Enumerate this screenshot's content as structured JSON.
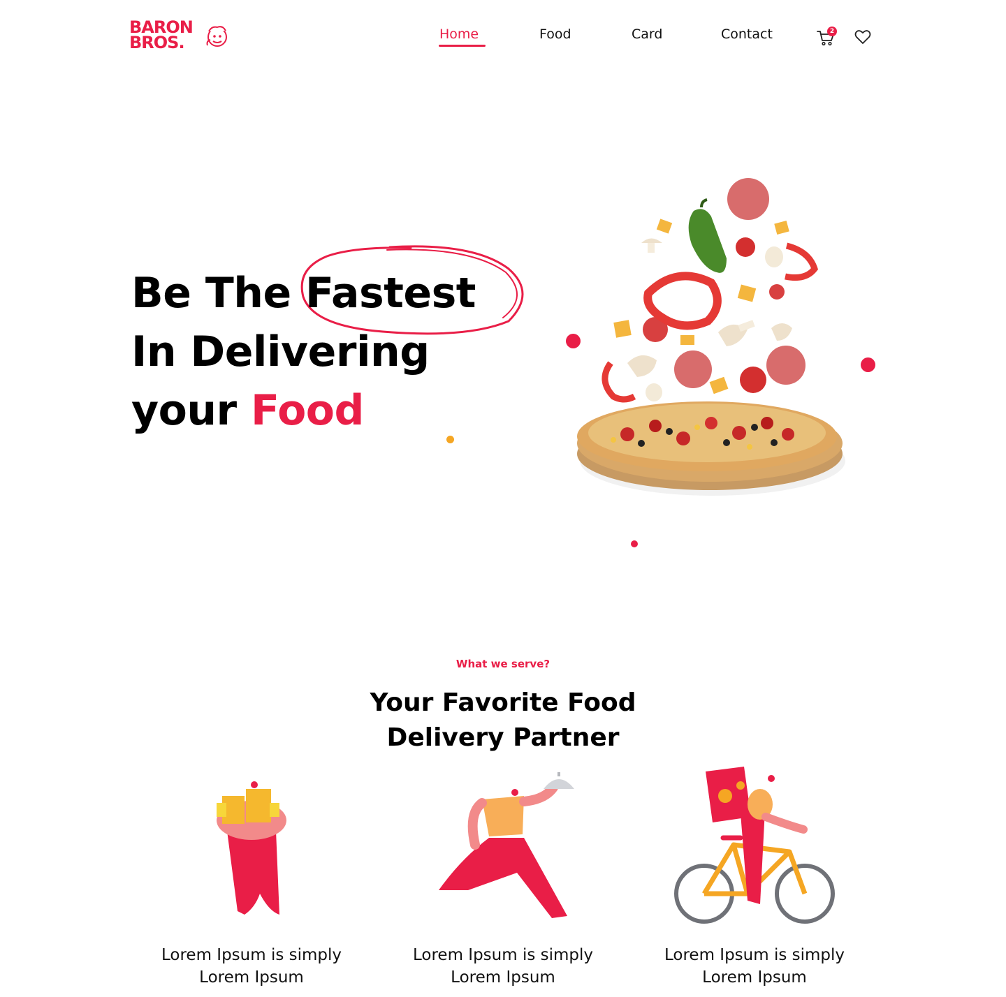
{
  "brand": {
    "logo_line1": "BARON",
    "logo_line2": "BROS.",
    "accent_color": "#e91e47",
    "secondary_color": "#f5a623"
  },
  "nav": {
    "items": [
      {
        "label": "Home",
        "active": true
      },
      {
        "label": "Food",
        "active": false
      },
      {
        "label": "Card",
        "active": false
      },
      {
        "label": "Contact",
        "active": false
      }
    ],
    "cart_icon": "cart-icon",
    "cart_count": "2",
    "wishlist_icon": "heart-icon"
  },
  "hero": {
    "line1_prefix": "Be The ",
    "line1_highlight": "Fastest",
    "line2": "In Delivering",
    "line3_prefix": "your ",
    "line3_accent": "Food"
  },
  "section": {
    "subtitle": "What we serve?",
    "title_line1": "Your Favorite Food",
    "title_line2": "Delivery Partner"
  },
  "cards": [
    {
      "line1": "Lorem Ipsum is simply",
      "line2": "Lorem Ipsum",
      "illustration": "courier-carrying-boxes"
    },
    {
      "line1": "Lorem Ipsum is simply",
      "line2": "Lorem Ipsum",
      "illustration": "courier-running-with-cloche"
    },
    {
      "line1": "Lorem Ipsum is simply",
      "line2": "Lorem Ipsum",
      "illustration": "courier-on-bicycle"
    }
  ]
}
